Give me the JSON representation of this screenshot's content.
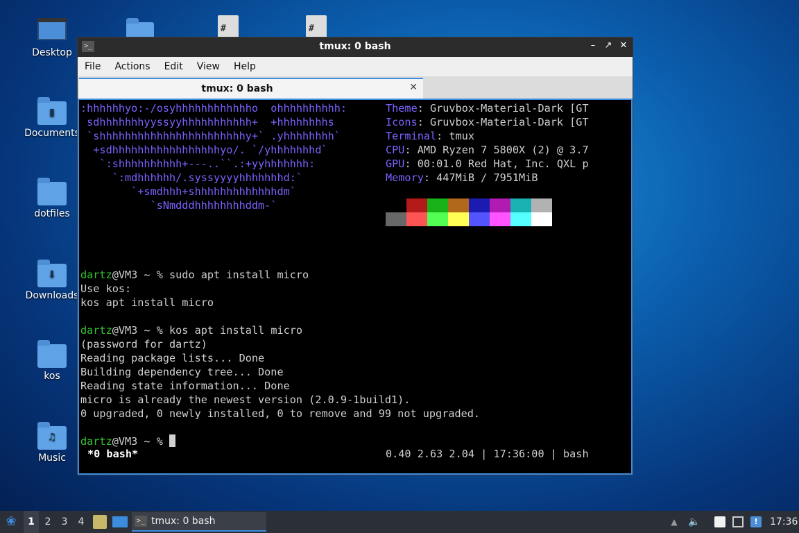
{
  "desktop": {
    "icons": [
      {
        "label": "Desktop"
      },
      {
        "label": "Documents"
      },
      {
        "label": "dotfiles"
      },
      {
        "label": "Downloads"
      },
      {
        "label": "kos"
      },
      {
        "label": "Music"
      }
    ]
  },
  "window": {
    "title": "tmux: 0 bash",
    "menu": [
      "File",
      "Actions",
      "Edit",
      "View",
      "Help"
    ],
    "tab_label": "tmux: 0 bash"
  },
  "terminal": {
    "ascii_art": [
      ":hhhhhhyo:-/osyhhhhhhhhhhhho  ohhhhhhhhhh:",
      " sdhhhhhhhyyssyyhhhhhhhhhhh+  +hhhhhhhhs",
      " `shhhhhhhhhhhhhhhhhhhhhhhy+` .yhhhhhhhh`",
      "  +sdhhhhhhhhhhhhhhhhhyo/. `/yhhhhhhhd`",
      "   `:shhhhhhhhhh+---..``.:+yyhhhhhhh:",
      "     `:mdhhhhhh/.syssyyyyhhhhhhhd:`",
      "        `+smdhhh+shhhhhhhhhhhhhdm`",
      "           `sNmdddhhhhhhhhddm-`"
    ],
    "info": [
      {
        "key": "Theme",
        "value": ": Gruvbox-Material-Dark [GT"
      },
      {
        "key": "Icons",
        "value": ": Gruvbox-Material-Dark [GT"
      },
      {
        "key": "Terminal",
        "value": ": tmux"
      },
      {
        "key": "CPU",
        "value": ": AMD Ryzen 7 5800X (2) @ 3.7"
      },
      {
        "key": "GPU",
        "value": ": 00:01.0 Red Hat, Inc. QXL p"
      },
      {
        "key": "Memory",
        "value": ": 447MiB / 7951MiB"
      }
    ],
    "palette_row1": [
      "#000000",
      "#b31b1b",
      "#18b218",
      "#b2681b",
      "#1b1bb2",
      "#b21bb2",
      "#18b2b2",
      "#b2b2b2"
    ],
    "palette_row2": [
      "#686868",
      "#ff5454",
      "#54ff54",
      "#ffff54",
      "#5454ff",
      "#ff54ff",
      "#54ffff",
      "#ffffff"
    ],
    "prompt_user": "dartz",
    "prompt_host": "@VM3 ~ % ",
    "cmd1": "sudo apt install micro",
    "out1": [
      "Use kos:",
      "kos apt install micro"
    ],
    "cmd2": "kos apt install micro",
    "out2": [
      "(password for dartz)",
      "Reading package lists... Done",
      "Building dependency tree... Done",
      "Reading state information... Done",
      "micro is already the newest version (2.0.9-1build1).",
      "0 upgraded, 0 newly installed, 0 to remove and 99 not upgraded."
    ],
    "status_left": "*0 bash*",
    "status_right": "0.40 2.63 2.04 | 17:36:00 | bash"
  },
  "taskbar": {
    "workspaces": [
      "1",
      "2",
      "3",
      "4"
    ],
    "task_label": "tmux: 0 bash",
    "clock": "17:36"
  }
}
